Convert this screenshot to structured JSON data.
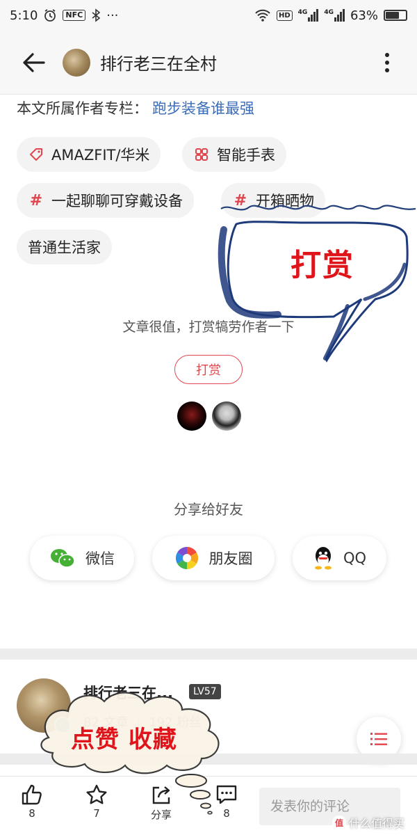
{
  "status_bar": {
    "time": "5:10",
    "nfc": "NFC",
    "hd": "HD",
    "net1": "4G",
    "net2": "4G",
    "battery_text": "63%",
    "battery_level": 0.63
  },
  "nav": {
    "title": "排行老三在全村"
  },
  "column": {
    "label": "本文所属作者专栏：",
    "link": "跑步装备谁最强"
  },
  "tags": [
    {
      "label": "AMAZFIT/华米",
      "icon": "tag-icon"
    },
    {
      "label": "智能手表",
      "icon": "grid-icon"
    },
    {
      "label": "一起聊聊可穿戴设备",
      "icon": "hashtag-icon"
    },
    {
      "label": "开箱晒物",
      "icon": "hashtag-icon"
    },
    {
      "label": "普通生活家",
      "icon": ""
    }
  ],
  "reward": {
    "prompt": "文章很值，打赏犒劳作者一下",
    "button": "打赏"
  },
  "share": {
    "title": "分享给好友",
    "items": [
      {
        "label": "微信",
        "icon": "wechat-icon"
      },
      {
        "label": "朋友圈",
        "icon": "moments-icon"
      },
      {
        "label": "QQ",
        "icon": "qq-icon"
      }
    ]
  },
  "author": {
    "name": "排行老三在...",
    "level": "LV57",
    "articles": "82 文章",
    "fans": "192 粉丝"
  },
  "bottom_bar": {
    "like_count": "8",
    "favorite_count": "7",
    "share_label": "分享",
    "comment_count": "8",
    "comment_placeholder": "发表你的评论"
  },
  "overlays": {
    "speech_bubble_text": "打赏",
    "cloud_text": "点赞 收藏",
    "watermark": "什么值得买",
    "watermark_mark": "值",
    "accent_color": "#e0151c"
  }
}
